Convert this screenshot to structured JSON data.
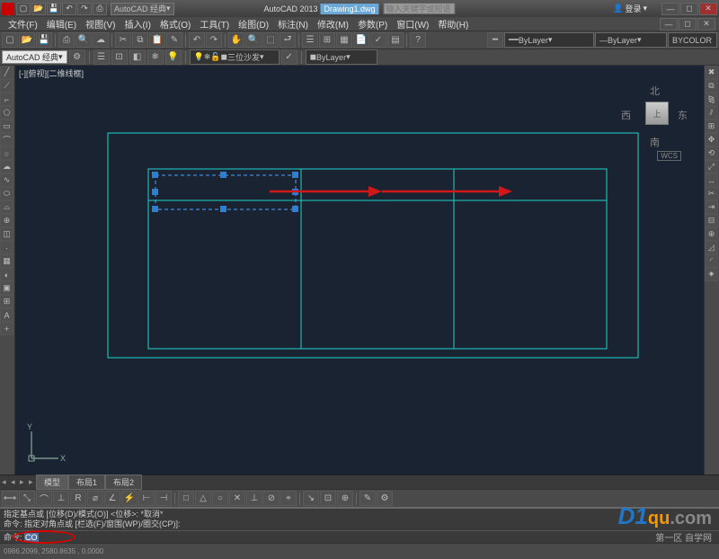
{
  "title": {
    "app": "AutoCAD 2013",
    "doc": "Drawing1.dwg",
    "search_ph": "输入关键字或短语",
    "login": "登录"
  },
  "workspace": {
    "label": "AutoCAD 经典"
  },
  "menus": [
    "文件(F)",
    "编辑(E)",
    "视图(V)",
    "插入(I)",
    "格式(O)",
    "工具(T)",
    "绘图(D)",
    "标注(N)",
    "修改(M)",
    "参数(P)",
    "窗口(W)",
    "帮助(H)"
  ],
  "layer_panel": {
    "current": "三位沙发",
    "linetype": "ByLayer",
    "lineweight": "ByLayer",
    "color": "ByLayer",
    "plot": "BYCOLOR"
  },
  "canvas": {
    "title": "[-][俯视][二维线框]"
  },
  "viewcube": {
    "n": "北",
    "s": "南",
    "e": "东",
    "w": "西",
    "top": "上",
    "wcs": "WCS"
  },
  "ucs": {
    "x": "X",
    "y": "Y"
  },
  "tabs": {
    "model": "模型",
    "layout1": "布局1",
    "layout2": "布局2"
  },
  "cmd": {
    "line1": "指定基点或 [位移(D)/模式(O)] <位移>:  *取消*",
    "line2": "命令: 指定对角点或 [栏选(F)/窗围(WP)/圈交(CP)]:",
    "prompt": "命令:",
    "input": "CO"
  },
  "status": {
    "coords": "0986.2099, 2580.8635 , 0.0000"
  },
  "watermark": {
    "brand": "D1",
    "mid": "qu",
    "suf": ".com",
    "sub": "第一区 自学网"
  },
  "chart_data": {
    "type": "table",
    "description": "CAD drawing: a large outer teal rectangle with an inner table grid of 3 columns × 1 row. The first column header cell is selected (shown with blue dashed selection and grips) and a red annotation arrow points from the first cell rightwards across the second cell to the third cell, indicating a COPY operation along +X."
  }
}
